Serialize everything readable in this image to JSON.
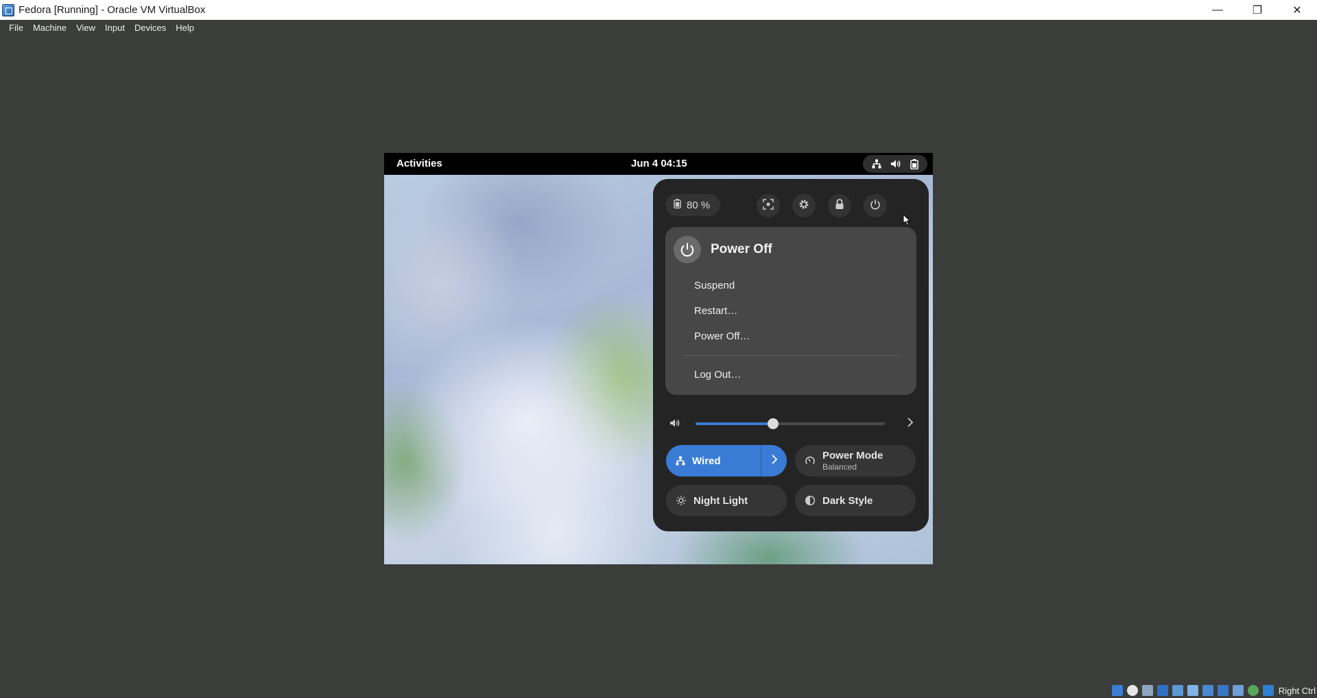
{
  "window": {
    "title": "Fedora [Running] - Oracle VM VirtualBox",
    "minimize_glyph": "—",
    "maximize_glyph": "❐",
    "close_glyph": "✕"
  },
  "menubar": {
    "items": [
      "File",
      "Machine",
      "View",
      "Input",
      "Devices",
      "Help"
    ]
  },
  "guest": {
    "topbar": {
      "activities": "Activities",
      "clock": "Jun 4  04:15",
      "tray_icons": [
        "network-wired-icon",
        "speaker-icon",
        "battery-icon"
      ]
    },
    "quick_settings": {
      "battery_label": "80 %",
      "system_buttons": [
        "screenshot-icon",
        "settings-gear-icon",
        "lock-icon",
        "power-icon"
      ],
      "power_menu": {
        "title": "Power Off",
        "items": [
          "Suspend",
          "Restart…",
          "Power Off…"
        ],
        "logout": "Log Out…"
      },
      "volume": {
        "level": 0.41
      },
      "toggles": {
        "wired": {
          "label": "Wired",
          "active": true
        },
        "power_mode": {
          "label": "Power Mode",
          "subtitle": "Balanced"
        },
        "night_light": {
          "label": "Night Light"
        },
        "dark_style": {
          "label": "Dark Style"
        }
      },
      "accent_color": "#3a7bd5"
    }
  },
  "host_status": {
    "host_key": "Right Ctrl"
  }
}
